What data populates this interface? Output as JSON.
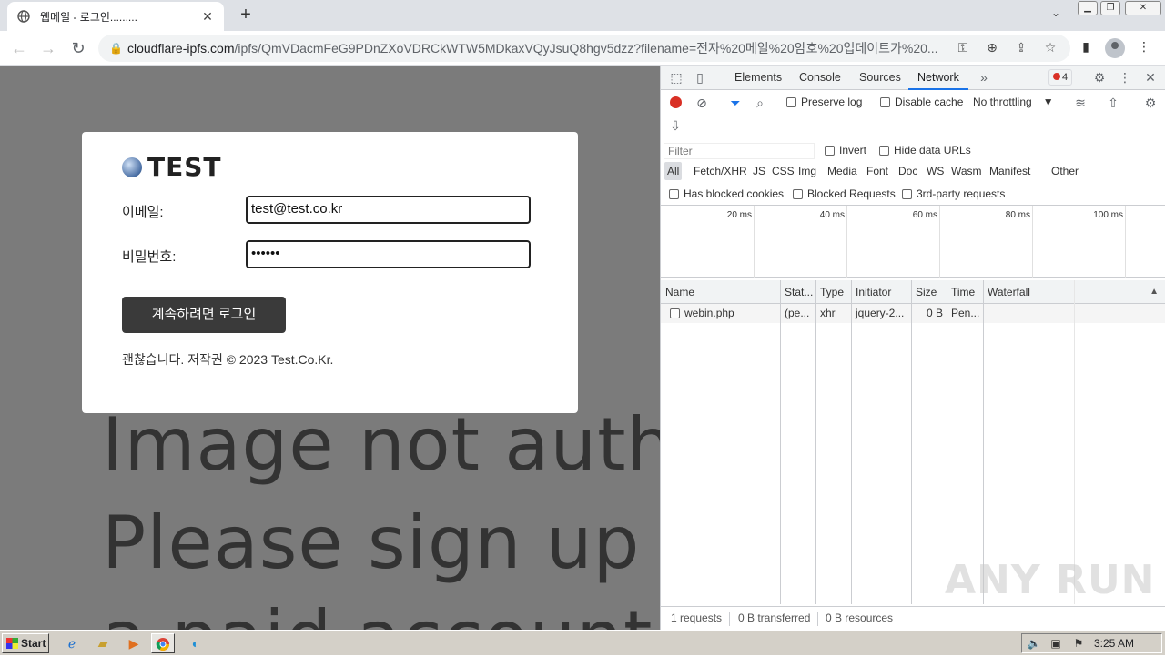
{
  "browser": {
    "tab_title": "웹메일 - 로그인.........",
    "address_domain": "cloudflare-ipfs.com",
    "address_path": "/ipfs/QmVDacmFeG9PDnZXoVDRCkWTW5MDkaxVQyJsuQ8hgv5dzz?filename=전자%20메일%20암호%20업데이트가%20..."
  },
  "page": {
    "logo_text": "TEST",
    "email_label": "이메일:",
    "email_value": "test@test.co.kr",
    "password_label": "비밀번호:",
    "password_value": "••••••",
    "login_button": "계속하려면 로그인",
    "copyright": "괜찮습니다. 저작권 © 2023 Test.Co.Kr.",
    "background_lines": [
      "Image not auth",
      "Please sign up",
      "a paid account"
    ]
  },
  "devtools": {
    "tabs": [
      "Elements",
      "Console",
      "Sources",
      "Network"
    ],
    "active_tab": "Network",
    "error_count": "4",
    "preserve_log": "Preserve log",
    "disable_cache": "Disable cache",
    "throttling": "No throttling",
    "filter_placeholder": "Filter",
    "invert": "Invert",
    "hide_data_urls": "Hide data URLs",
    "type_filters": [
      "All",
      "Fetch/XHR",
      "JS",
      "CSS",
      "Img",
      "Media",
      "Font",
      "Doc",
      "WS",
      "Wasm",
      "Manifest",
      "Other"
    ],
    "blocked_cookies": "Has blocked cookies",
    "blocked_requests": "Blocked Requests",
    "third_party": "3rd-party requests",
    "timeline_ticks": [
      "20 ms",
      "40 ms",
      "60 ms",
      "80 ms",
      "100 ms"
    ],
    "columns": [
      "Name",
      "Stat...",
      "Type",
      "Initiator",
      "Size",
      "Time",
      "Waterfall"
    ],
    "rows": [
      {
        "name": "webin.php",
        "status": "(pe...",
        "type": "xhr",
        "initiator": "jquery-2...",
        "size": "0 B",
        "time": "Pen..."
      }
    ],
    "status_requests": "1 requests",
    "status_transferred": "0 B transferred",
    "status_resources": "0 B resources"
  },
  "watermark": "ANY RUN",
  "taskbar": {
    "start": "Start",
    "clock": "3:25 AM"
  },
  "colors": {
    "record_red": "#d93025",
    "active_blue": "#1a73e8",
    "page_bg": "#7b7b7b",
    "button_dark": "#3a3a3a"
  }
}
